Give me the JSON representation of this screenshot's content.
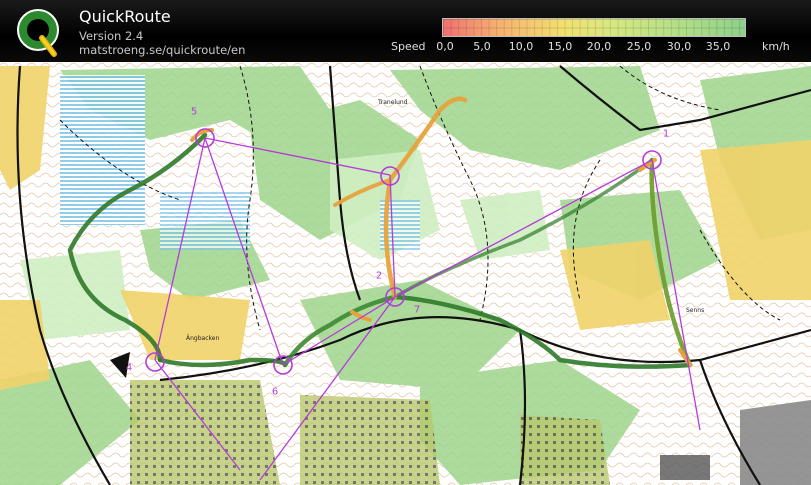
{
  "header": {
    "app_title": "QuickRoute",
    "version": "Version 2.4",
    "url": "matstroeng.se/quickroute/en",
    "speed_label": "Speed",
    "speed_unit": "km/h",
    "speed_ticks": [
      "0,0",
      "5,0",
      "10,0",
      "15,0",
      "20,0",
      "25,0",
      "30,0",
      "35,0"
    ]
  },
  "map": {
    "place_labels": [
      "Tranelund",
      "Ängbacken",
      "Senns"
    ],
    "controls": [
      "1",
      "2",
      "4",
      "5",
      "6",
      "7"
    ],
    "colors": {
      "course": "#b43cd8",
      "route_slow": "#e8a23c",
      "route_fast": "#2f7a2a",
      "forest_green": "#9fd58c",
      "open_yellow": "#f1d36a"
    }
  }
}
